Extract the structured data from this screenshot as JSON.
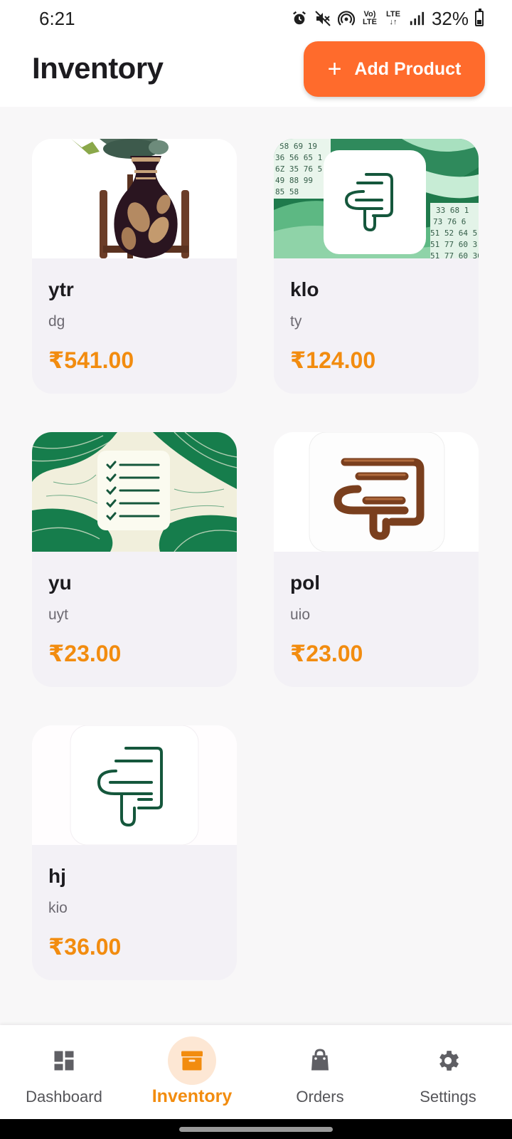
{
  "status_bar": {
    "time": "6:21",
    "volte": "Vo)",
    "lte_top": "LTE",
    "lte_sub": "LTE",
    "lte_arrows": "↓↑",
    "battery": "32%"
  },
  "header": {
    "title": "Inventory",
    "add_button_icon": "+",
    "add_button_label": "Add Product"
  },
  "products": [
    {
      "name": "ytr",
      "description": "dg",
      "price": "₹541.00",
      "image": "vase-photo"
    },
    {
      "name": "klo",
      "description": "ty",
      "price": "₹124.00",
      "image": "green-wave-logo"
    },
    {
      "name": "yu",
      "description": "uyt",
      "price": "₹23.00",
      "image": "checklist-swirl"
    },
    {
      "name": "pol",
      "description": "uio",
      "price": "₹23.00",
      "image": "wood-logo"
    },
    {
      "name": "hj",
      "description": "kio",
      "price": "₹36.00",
      "image": "green-line-logo"
    }
  ],
  "klo_image_digits": [
    "58 69 19",
    "36 56 65 1",
    "6Z 35 76 5",
    "49 88 99",
    "85 58",
    "33 68 1",
    "73 76 6",
    "51 52 64 5",
    "51 77 60 3",
    "51 77 60 30"
  ],
  "bottom_nav": [
    {
      "label": "Dashboard",
      "icon": "dashboard-icon",
      "active": false
    },
    {
      "label": "Inventory",
      "icon": "archive-icon",
      "active": true
    },
    {
      "label": "Orders",
      "icon": "shopping-bag-icon",
      "active": false
    },
    {
      "label": "Settings",
      "icon": "gear-icon",
      "active": false
    }
  ],
  "colors": {
    "accent": "#ff6b2c",
    "price": "#f28c0f",
    "card_bg": "#f3f1f6",
    "logo_green": "#15573c"
  }
}
